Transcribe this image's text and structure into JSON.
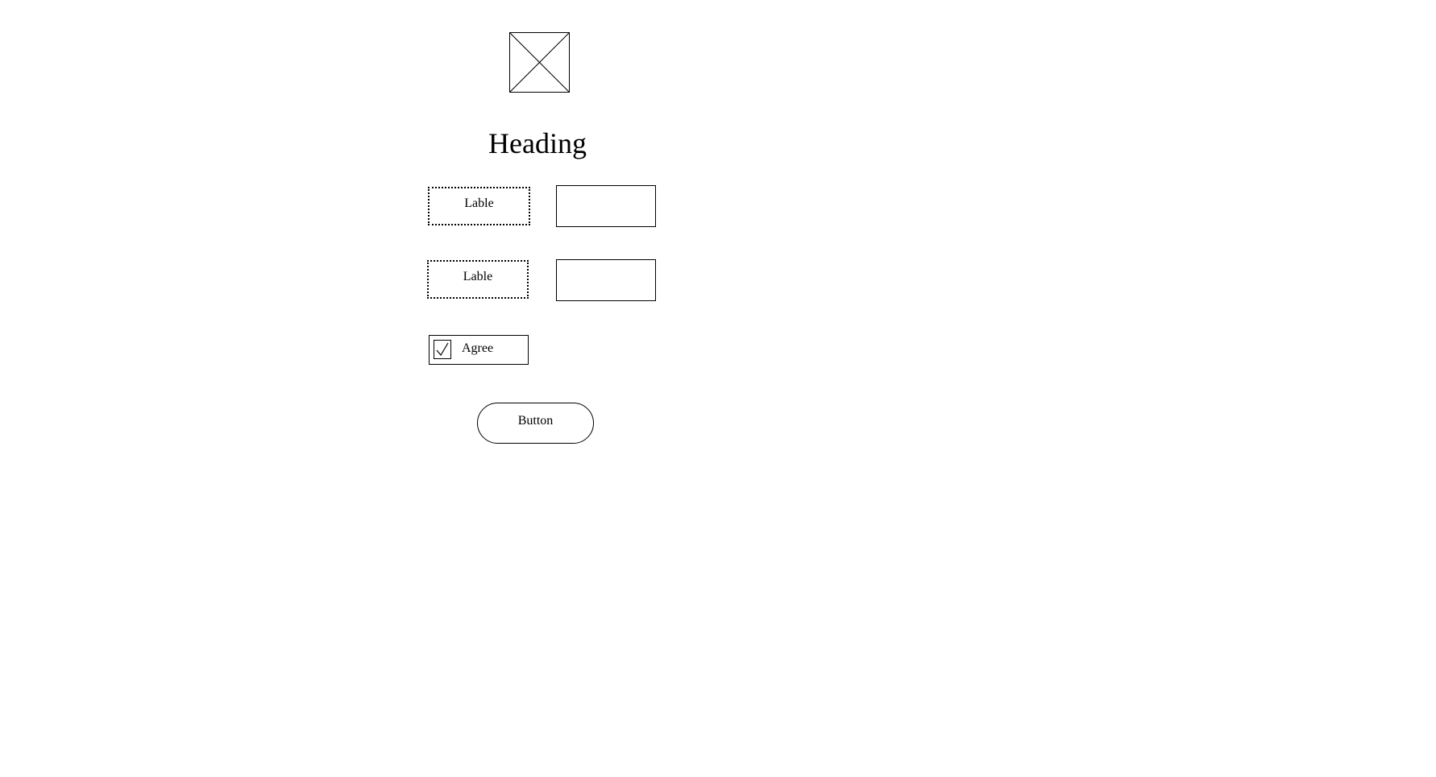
{
  "image": {
    "icon": "image-placeholder-icon"
  },
  "heading": "Heading",
  "form": {
    "fields": [
      {
        "label": "Lable",
        "value": "",
        "placeholder": ""
      },
      {
        "label": "Lable",
        "value": "",
        "placeholder": ""
      }
    ],
    "checkbox": {
      "label": "Agree",
      "checked": true,
      "icon": "checkmark-icon"
    },
    "button_label": "Button"
  }
}
